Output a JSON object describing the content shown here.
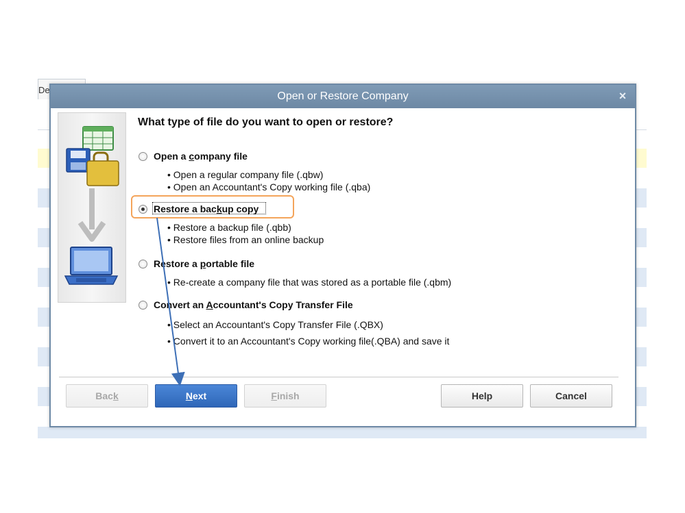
{
  "background": {
    "tab_label": "Def"
  },
  "dialog": {
    "title": "Open or Restore Company",
    "close_label": "×",
    "question": "What type of file do you want to open or restore?",
    "options": [
      {
        "label_pre": "Open a ",
        "label_u": "c",
        "label_post": "ompany file",
        "selected": false,
        "bullets": [
          "• Open a regular company file (.qbw)",
          "• Open an Accountant's Copy working file (.qba)"
        ]
      },
      {
        "label_pre": "Restore a bac",
        "label_u": "k",
        "label_post": "up copy",
        "selected": true,
        "bullets": [
          "• Restore a backup file (.qbb)",
          "• Restore files from an online backup"
        ]
      },
      {
        "label_pre": "Restore a ",
        "label_u": "p",
        "label_post": "ortable file",
        "selected": false,
        "bullets": [
          "• Re-create a company file that was stored as a portable file (.qbm)"
        ]
      },
      {
        "label_pre": "Convert an ",
        "label_u": "A",
        "label_post": "ccountant's Copy Transfer File",
        "selected": false,
        "bullets": [
          "• Select an Accountant's Copy Transfer File (.QBX)",
          "• Convert it to an Accountant's Copy working file(.QBA) and save it"
        ]
      }
    ],
    "buttons": {
      "back_pre": "Bac",
      "back_u": "k",
      "back_post": "",
      "next_pre": "",
      "next_u": "N",
      "next_post": "ext",
      "finish_pre": "",
      "finish_u": "F",
      "finish_post": "inish",
      "help": "Help",
      "cancel": "Cancel"
    }
  },
  "colors": {
    "title_bar": "#7590ac",
    "highlight": "#f4a45a",
    "arrow": "#3d6fb6",
    "primary_button": "#2e66b8"
  }
}
